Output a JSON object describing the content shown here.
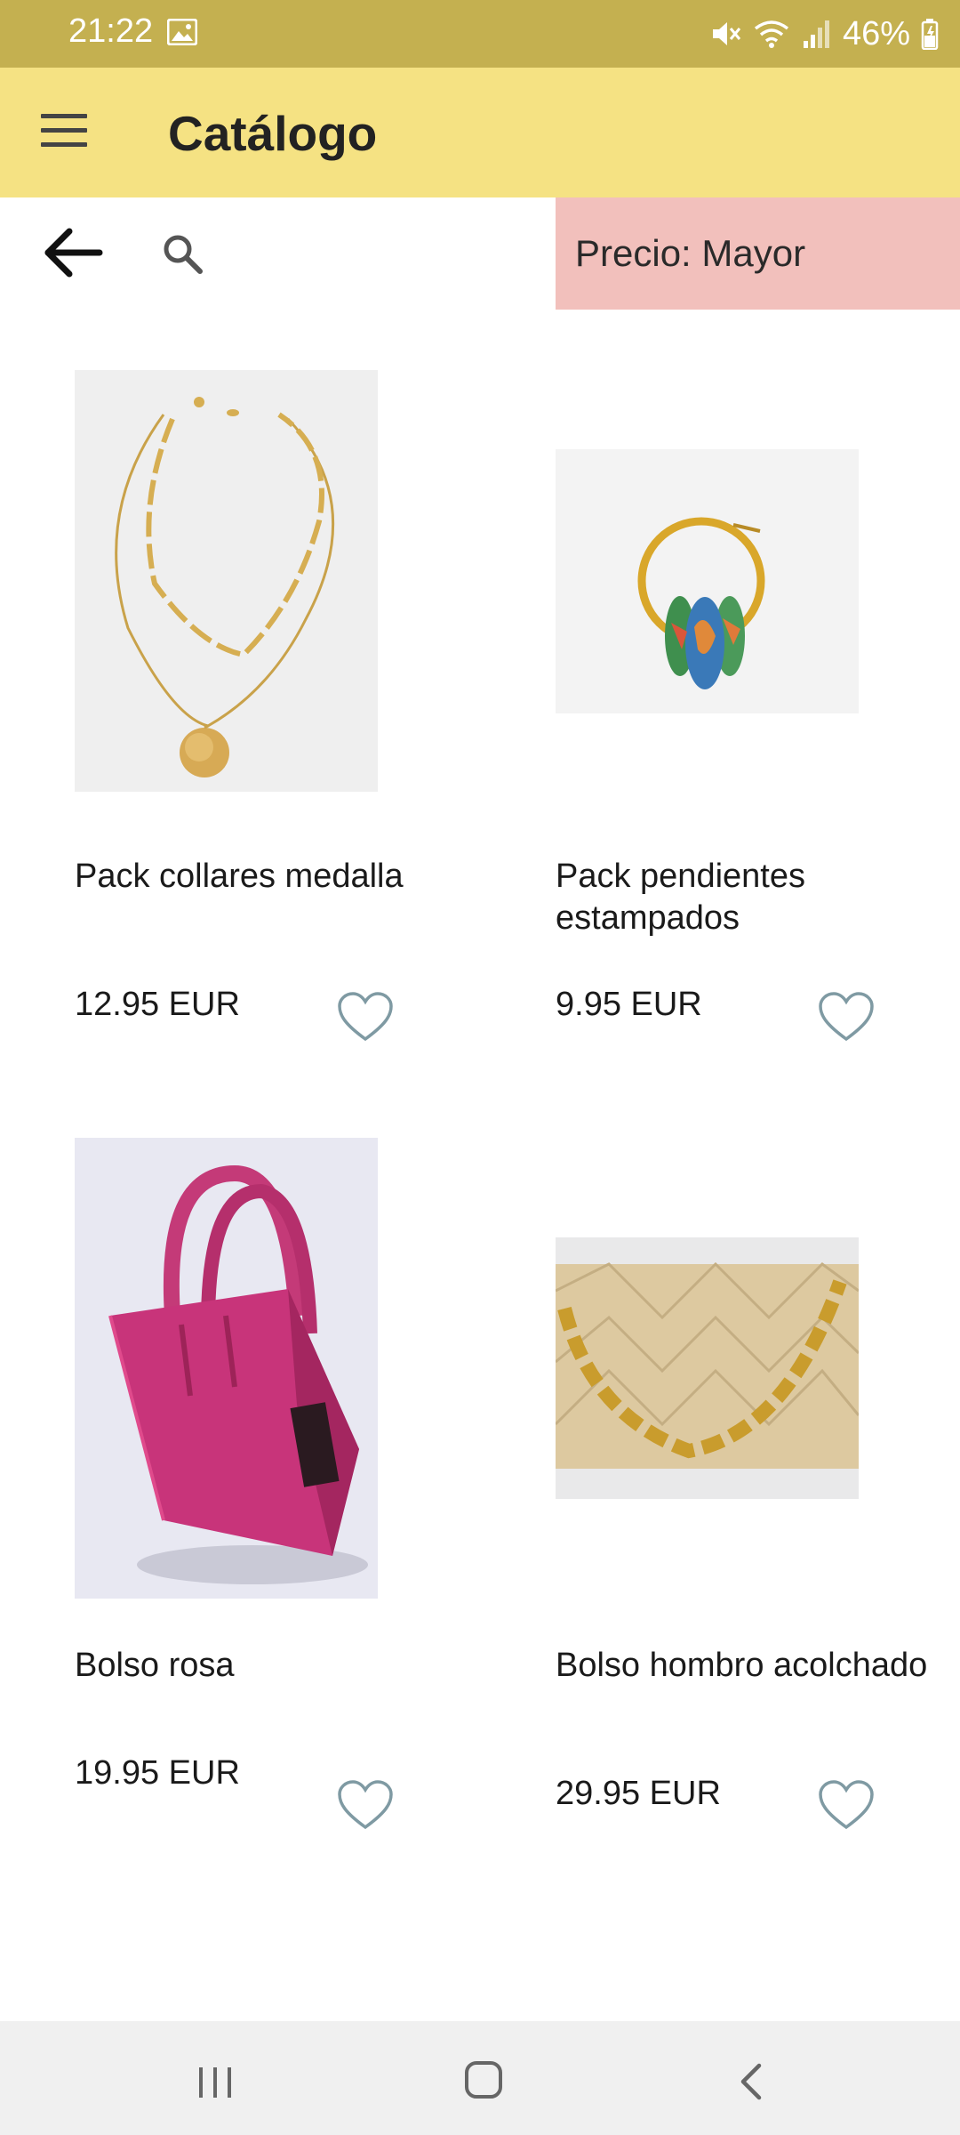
{
  "status_bar": {
    "time": "21:22",
    "battery": "46%",
    "icons": [
      "gallery-icon",
      "mute-icon",
      "wifi-icon",
      "signal-icon",
      "battery-icon"
    ]
  },
  "app_bar": {
    "title": "Catálogo",
    "menu_icon": "hamburger-menu-icon"
  },
  "toolbar": {
    "back_icon": "arrow-back-icon",
    "search_icon": "search-icon",
    "sort_label": "Precio: Mayor"
  },
  "products": [
    {
      "name": "Pack collares medalla",
      "price": "12.95 EUR",
      "image": "gold-necklace-image",
      "favorite": false
    },
    {
      "name": "Pack pendientes estampados",
      "price": "9.95 EUR",
      "image": "hoop-earring-image",
      "favorite": false
    },
    {
      "name": "Bolso rosa",
      "price": "19.95 EUR",
      "image": "pink-handbag-image",
      "favorite": false
    },
    {
      "name": "Bolso hombro acolchado",
      "price": "29.95 EUR",
      "image": "quilted-shoulder-bag-image",
      "favorite": false
    }
  ],
  "nav_bar": {
    "icons": [
      "recent-apps-icon",
      "home-icon",
      "back-icon"
    ]
  },
  "colors": {
    "status_bar": "#c4b050",
    "app_bar": "#f5e283",
    "sort_box": "#f2c0bc",
    "heart_outline": "#7f9aa3"
  }
}
